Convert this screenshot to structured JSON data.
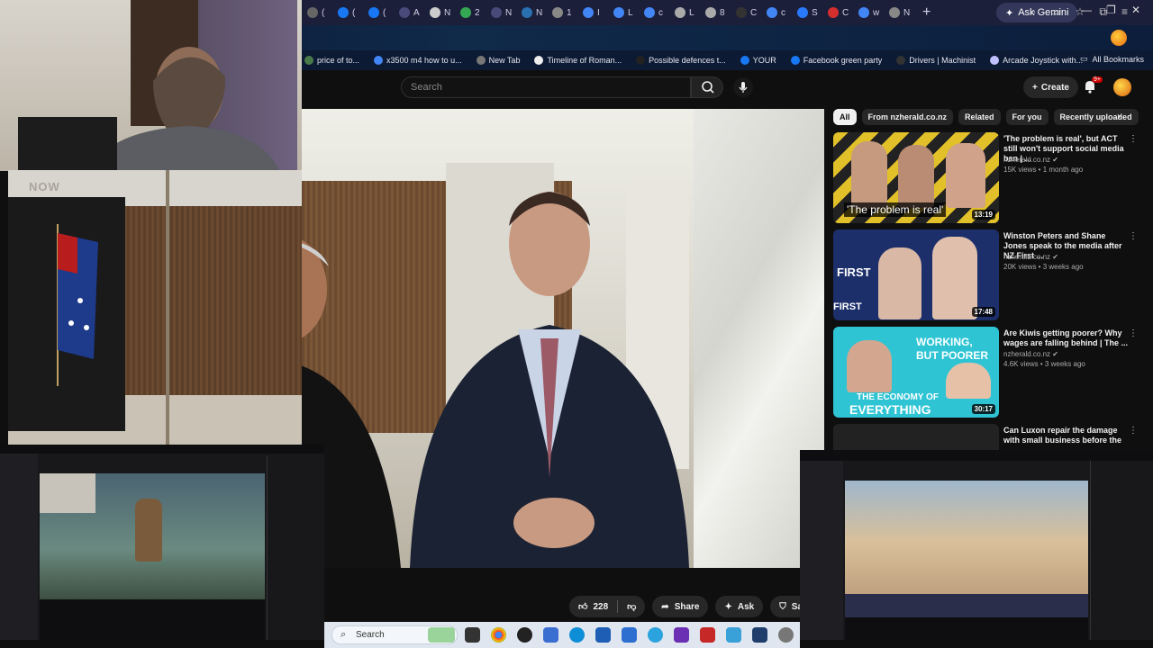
{
  "browser": {
    "tabs": [
      {
        "label": "(",
        "color": "#666"
      },
      {
        "label": "(",
        "color": "#1877f2"
      },
      {
        "label": "(",
        "color": "#1877f2"
      },
      {
        "label": "A",
        "color": "#4a4a7a"
      },
      {
        "label": "N",
        "color": "#cccccc"
      },
      {
        "label": "2",
        "color": "#34a853"
      },
      {
        "label": "N",
        "color": "#4a4a7a"
      },
      {
        "label": "N",
        "color": "#2a6fb0"
      },
      {
        "label": "1",
        "color": "#888"
      },
      {
        "label": "I",
        "color": "#4285f4"
      },
      {
        "label": "L",
        "color": "#4285f4"
      },
      {
        "label": "c",
        "color": "#4285f4"
      },
      {
        "label": "L",
        "color": "#aaaaaa"
      },
      {
        "label": "8",
        "color": "#aaaaaa"
      },
      {
        "label": "C",
        "color": "#333"
      },
      {
        "label": "c",
        "color": "#4285f4"
      },
      {
        "label": "S",
        "color": "#2979ff"
      },
      {
        "label": "C",
        "color": "#d32f2f"
      },
      {
        "label": "w",
        "color": "#4285f4"
      },
      {
        "label": "N",
        "color": "#888"
      }
    ],
    "new_tab": "+",
    "ask_gemini": "Ask Gemini",
    "bookmarks": [
      {
        "label": "price of to...",
        "color": "#4a7a4a"
      },
      {
        "label": "x3500 m4 how to u...",
        "color": "#4285f4"
      },
      {
        "label": "New Tab",
        "color": "#777"
      },
      {
        "label": "Timeline of Roman...",
        "color": "#eeeeee"
      },
      {
        "label": "Possible defences t...",
        "color": "#222"
      },
      {
        "label": "YOUR",
        "color": "#1877f2"
      },
      {
        "label": "Facebook green party",
        "color": "#1877f2"
      },
      {
        "label": "Drivers | Machinist",
        "color": "#333"
      },
      {
        "label": "Arcade Joystick with...",
        "color": "#c0c0ff"
      }
    ],
    "all_bookmarks": "All Bookmarks"
  },
  "youtube": {
    "search_placeholder": "Search",
    "create_label": "Create",
    "notif_badge": "9+",
    "actions": {
      "likes": "228",
      "share": "Share",
      "ask": "Ask",
      "save": "Save"
    },
    "chips": [
      "All",
      "From nzherald.co.nz",
      "Related",
      "For you",
      "Recently uploaded"
    ],
    "recommendations": [
      {
        "title": "'The problem is real', but ACT still won't support social media ban | ...",
        "channel": "nzherald.co.nz",
        "meta": "15K views • 1 month ago",
        "duration": "13:19",
        "overlay": "'The problem is real'",
        "bg": "#3a3a3a"
      },
      {
        "title": "Winston Peters and Shane Jones speak to the media after NZ First ...",
        "channel": "nzherald.co.nz",
        "meta": "20K views • 3 weeks ago",
        "duration": "17:48",
        "overlay": "",
        "bg": "#1c2f6b"
      },
      {
        "title": "Are Kiwis getting poorer? Why wages are falling behind | The ...",
        "channel": "nzherald.co.nz",
        "meta": "4.6K views • 3 weeks ago",
        "duration": "30:17",
        "overlay": "",
        "bg": "#2ec4d4"
      },
      {
        "title": "Can Luxon repair the damage with small business before the ...",
        "channel": "",
        "meta": "",
        "duration": "",
        "overlay": "",
        "bg": "#222222"
      }
    ],
    "thumb2_text": {
      "a": "FIRST",
      "b": "FIRST"
    },
    "thumb3_text": {
      "a": "WORKING,",
      "b": "BUT POORER",
      "c": "THE ECONOMY OF",
      "d": "EVERYTHING"
    }
  },
  "overlay": {
    "now_text": "NOW"
  },
  "taskbar": {
    "search_label": "Search"
  }
}
